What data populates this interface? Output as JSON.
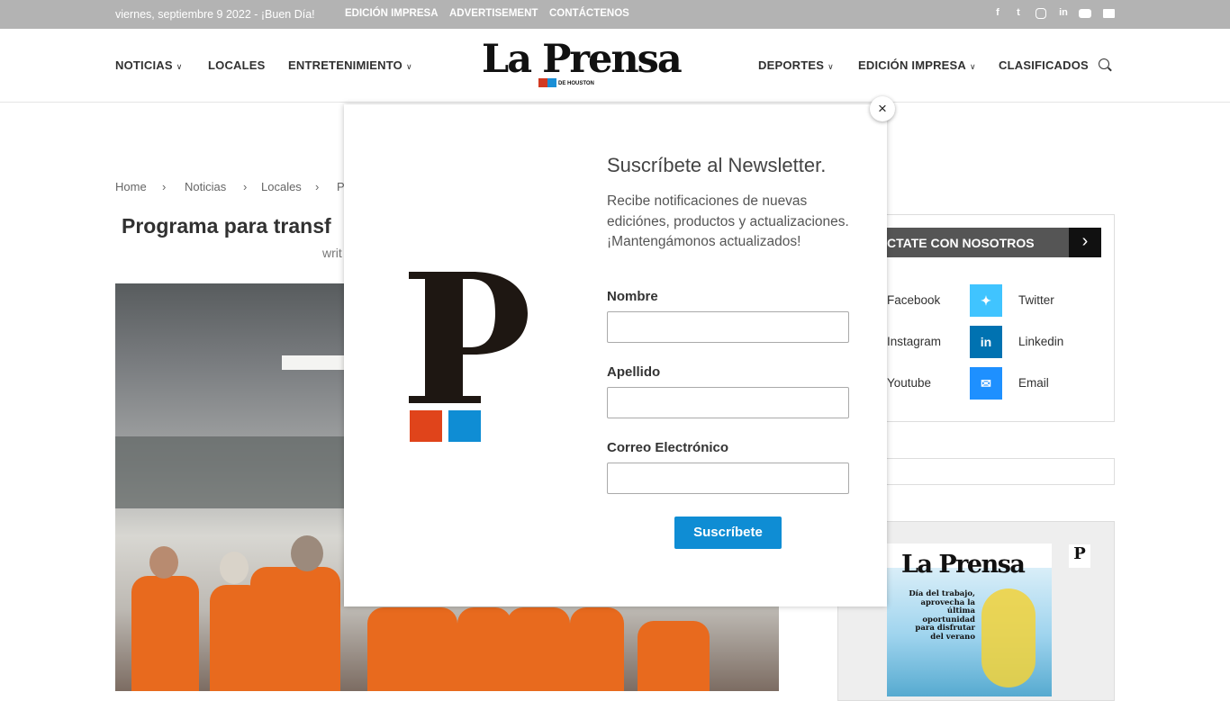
{
  "topbar": {
    "date": "viernes, septiembre 9 2022 - ¡Buen Día!",
    "links": [
      "EDICIÓN IMPRESA",
      "ADVERTISEMENT",
      "CONTÁCTENOS"
    ],
    "social_icons": [
      "facebook-icon",
      "twitter-icon",
      "instagram-icon",
      "linkedin-icon",
      "youtube-icon",
      "email-icon"
    ]
  },
  "header": {
    "logo_text": "La Prensa",
    "logo_sub": "DE HOUSTON",
    "nav_left": [
      "NOTICIAS",
      "LOCALES",
      "ENTRETENIMIENTO"
    ],
    "nav_right": [
      "DEPORTES",
      "EDICIÓN IMPRESA",
      "CLASIFICADOS"
    ]
  },
  "breadcrumb": [
    "Home",
    "Noticias",
    "Locales",
    "P"
  ],
  "article": {
    "title": "Programa para transf",
    "byline": "writ"
  },
  "sidebar": {
    "contact_title": "CTATE CON NOSOTROS",
    "social": [
      {
        "label": "Facebook"
      },
      {
        "label": "Twitter",
        "color": "#40c4ff"
      },
      {
        "label": "Instagram"
      },
      {
        "label": "Linkedin",
        "color": "#0072b1"
      },
      {
        "label": "Youtube"
      },
      {
        "label": "Email",
        "color": "#1e90ff"
      }
    ],
    "cover": {
      "logo": "La Prensa",
      "headline": "Día del trabajo, aprovecha la última oportunidad para disfrutar del verano"
    }
  },
  "modal": {
    "title": "Suscríbete al Newsletter.",
    "description": "Recibe notificaciones de nuevas ediciónes, productos y actualizaciones. ¡Mantengámonos actualizados!",
    "fields": [
      {
        "label": "Nombre",
        "value": ""
      },
      {
        "label": "Apellido",
        "value": ""
      },
      {
        "label": "Correo Electrónico",
        "value": ""
      }
    ],
    "submit_label": "Suscríbete",
    "close_label": "×",
    "brand_colors": [
      "#e0441b",
      "#0f8dd4"
    ]
  }
}
